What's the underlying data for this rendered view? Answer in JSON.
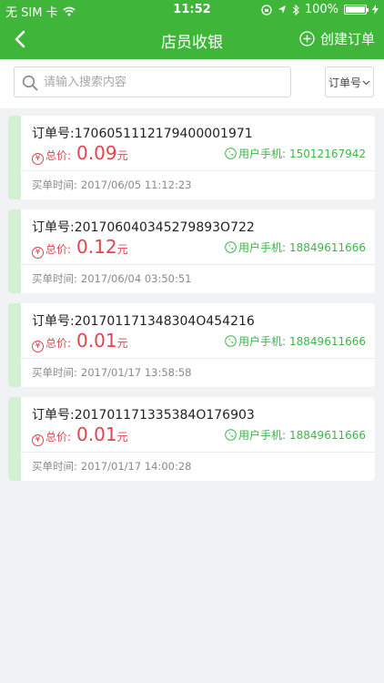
{
  "status_bar": {
    "carrier": "无 SIM 卡",
    "time": "11:52",
    "battery": "100%"
  },
  "nav": {
    "title": "店员收银",
    "create_label": "创建订单"
  },
  "search": {
    "placeholder": "请输入搜索内容",
    "value": "",
    "filter_label": "订单号"
  },
  "labels": {
    "order_prefix": "订单号:",
    "total_label": "总价:",
    "currency_unit": "元",
    "phone_label": "用户手机:",
    "time_label": "买单时间:"
  },
  "orders": [
    {
      "order_no": "1706051112179400001971",
      "price": "0.09",
      "phone": "15012167942",
      "time": "2017/06/05 11:12:23"
    },
    {
      "order_no": "201706040345279893O722",
      "price": "0.12",
      "phone": "18849611666",
      "time": "2017/06/04 03:50:51"
    },
    {
      "order_no": "201701171348304O454216",
      "price": "0.01",
      "phone": "18849611666",
      "time": "2017/01/17 13:58:58"
    },
    {
      "order_no": "201701171335384O176903",
      "price": "0.01",
      "phone": "18849611666",
      "time": "2017/01/17 14:00:28"
    }
  ],
  "colors": {
    "brand": "#3fb53a",
    "price": "#e0444e",
    "phone": "#3cb54a"
  }
}
